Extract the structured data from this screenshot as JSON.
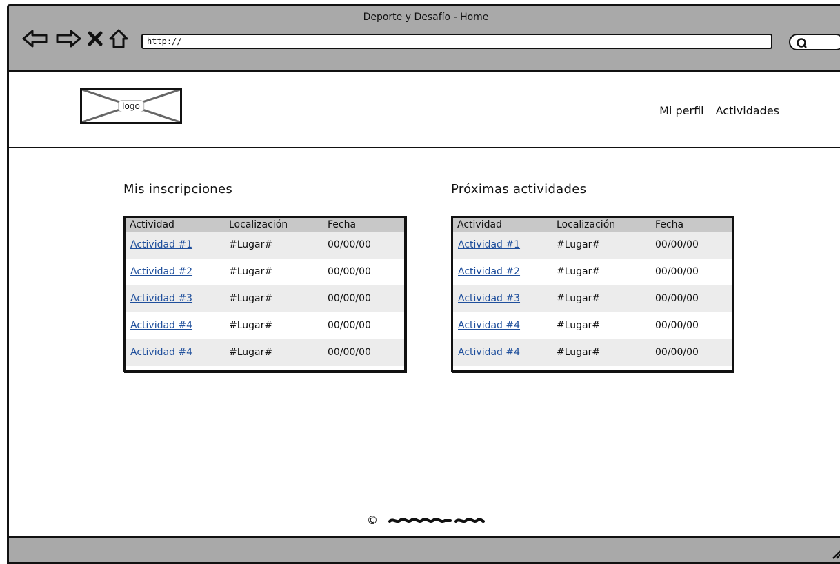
{
  "window": {
    "title": "Deporte y Desafío - Home"
  },
  "browser": {
    "url": "http://",
    "nav_icons": [
      "back-arrow-icon",
      "forward-arrow-icon",
      "close-x-icon",
      "home-icon"
    ],
    "search_icon": "search-icon"
  },
  "header": {
    "logo_label": "logo",
    "nav": [
      "Mi perfil",
      "Actividades"
    ]
  },
  "sections": [
    {
      "title": "Mis inscripciones",
      "columns": [
        "Actividad",
        "Localización",
        "Fecha"
      ],
      "rows": [
        [
          "Actividad #1",
          "#Lugar#",
          "00/00/00"
        ],
        [
          "Actividad #2",
          "#Lugar#",
          "00/00/00"
        ],
        [
          "Actividad #3",
          "#Lugar#",
          "00/00/00"
        ],
        [
          "Actividad #4",
          "#Lugar#",
          "00/00/00"
        ],
        [
          "Actividad #4",
          "#Lugar#",
          "00/00/00"
        ]
      ]
    },
    {
      "title": "Próximas actividades",
      "columns": [
        "Actividad",
        "Localización",
        "Fecha"
      ],
      "rows": [
        [
          "Actividad #1",
          "#Lugar#",
          "00/00/00"
        ],
        [
          "Actividad #2",
          "#Lugar#",
          "00/00/00"
        ],
        [
          "Actividad #3",
          "#Lugar#",
          "00/00/00"
        ],
        [
          "Actividad #4",
          "#Lugar#",
          "00/00/00"
        ],
        [
          "Actividad #4",
          "#Lugar#",
          "00/00/00"
        ]
      ]
    }
  ],
  "footer": {
    "copyright_symbol": "©"
  },
  "colors": {
    "chrome": "#a9a9a9",
    "link": "#1f4f9c",
    "table_header": "#c8c8c8",
    "row_alt": "#ececec"
  }
}
